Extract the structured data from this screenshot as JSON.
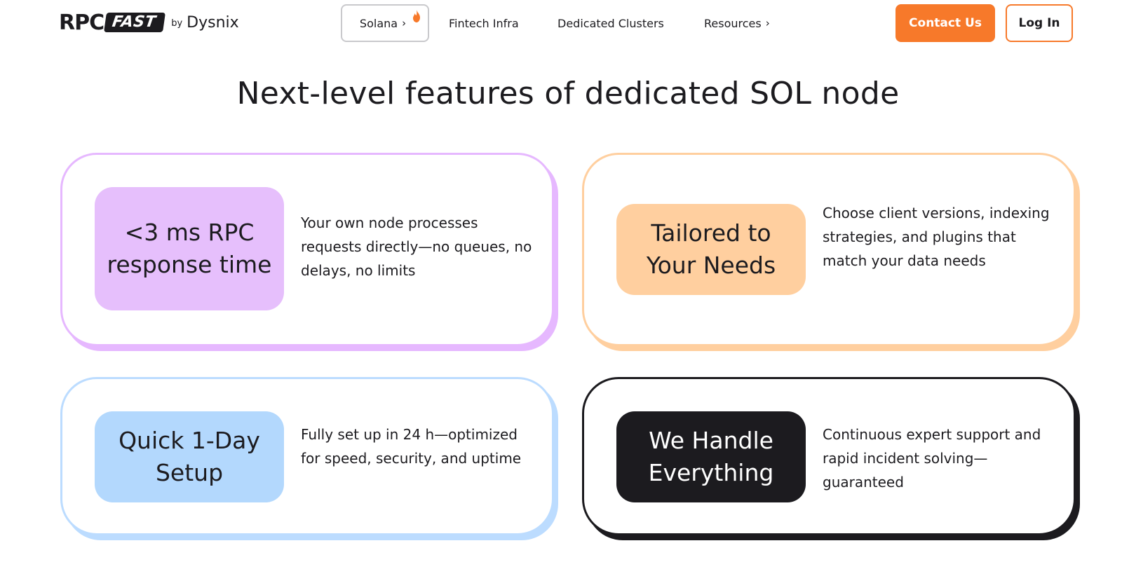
{
  "header": {
    "logo": {
      "rpc": "RPC",
      "fast": "FAST",
      "by": "by",
      "dysnix": "Dysnix"
    },
    "nav": [
      {
        "label": "Solana",
        "has_chevron": true,
        "has_flame": true
      },
      {
        "label": "Fintech Infra"
      },
      {
        "label": "Dedicated Clusters"
      },
      {
        "label": "Resources",
        "has_chevron": true
      }
    ],
    "contact_label": "Contact Us",
    "login_label": "Log In"
  },
  "page_title": "Next-level features of dedicated SOL node",
  "features": [
    {
      "title": "<3 ms RPC response time",
      "description": "Your own node processes requests directly—no queues, no delays, no limits",
      "accent": "#e6b8ff"
    },
    {
      "title": "Tailored to Your Needs",
      "description": "Choose client versions, indexing strategies, and plugins that match your data needs",
      "accent": "#ffcf9f"
    },
    {
      "title": "Quick 1-Day Setup",
      "description": "Fully set up in 24 h—optimized for speed, security, and uptime",
      "accent": "#bcdcff"
    },
    {
      "title": "We Handle Everything",
      "description": "Continuous expert support and rapid incident solving—guaranteed",
      "accent": "#1c1b1f"
    }
  ],
  "colors": {
    "brand_orange": "#f7792a",
    "text": "#1c1b1f",
    "background": "#ffffff"
  }
}
